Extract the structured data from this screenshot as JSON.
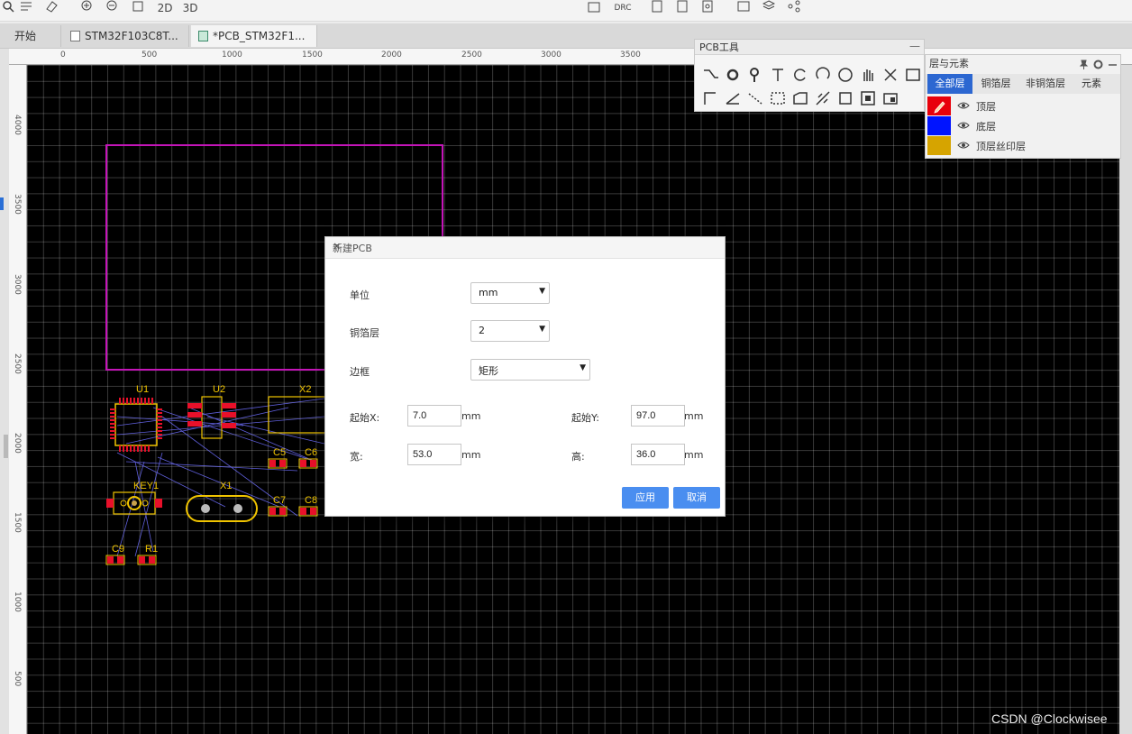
{
  "toolbar": {
    "btn_2d": "2D",
    "btn_3d": "3D",
    "btn_drc": "DRC"
  },
  "tabs": [
    {
      "label": "开始"
    },
    {
      "label": "STM32F103C8T..."
    },
    {
      "label": "*PCB_STM32F1..."
    }
  ],
  "ruler": {
    "h": [
      "0",
      "500",
      "1000",
      "1500",
      "2000",
      "2500",
      "3000",
      "3500"
    ],
    "v": [
      "4000",
      "3500",
      "3000",
      "2500",
      "2000",
      "1500",
      "1000",
      "500"
    ]
  },
  "pcb_tools": {
    "title": "PCB工具",
    "minimize": "—"
  },
  "layers_panel": {
    "title": "层与元素",
    "tabs": [
      "全部层",
      "铜箔层",
      "非铜箔层",
      "元素"
    ],
    "layers": [
      {
        "name": "顶层",
        "color": "#e8000b"
      },
      {
        "name": "底层",
        "color": "#0014ff"
      },
      {
        "name": "顶层丝印层",
        "color": "#d6a400"
      }
    ]
  },
  "board": {
    "components": [
      "U1",
      "U2",
      "X2",
      "C5",
      "C6",
      "KEY1",
      "X1",
      "C7",
      "C8",
      "C9",
      "R1"
    ]
  },
  "dialog": {
    "title": "新建PCB",
    "close": "✕",
    "unit_label": "单位",
    "unit_value": "mm",
    "copper_label": "铜箔层",
    "copper_value": "2",
    "border_label": "边框",
    "border_value": "矩形",
    "start_x_label": "起始X:",
    "start_x": "7.0",
    "start_y_label": "起始Y:",
    "start_y": "97.0",
    "width_label": "宽:",
    "width": "53.0",
    "height_label": "高:",
    "height": "36.0",
    "mm": "mm",
    "apply": "应用",
    "cancel": "取消"
  },
  "watermark": "CSDN @Clockwisee"
}
